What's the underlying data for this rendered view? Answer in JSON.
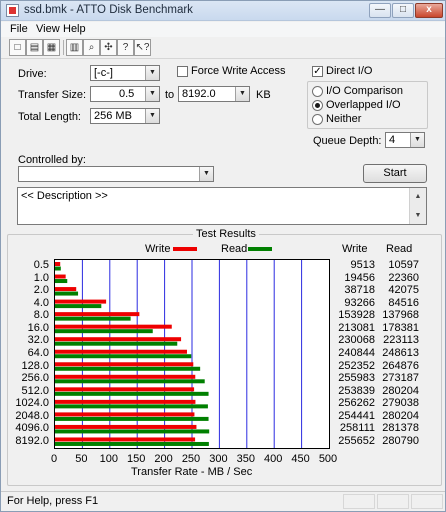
{
  "window": {
    "title": "ssd.bmk - ATTO Disk Benchmark",
    "min_glyph": "—",
    "max_glyph": "□",
    "close_glyph": "x"
  },
  "menu": [
    "File",
    "View",
    "Help"
  ],
  "toolbar": [
    {
      "name": "new-icon",
      "glyph": "□"
    },
    {
      "name": "open-icon",
      "glyph": "▤"
    },
    {
      "name": "save-icon",
      "glyph": "▦"
    },
    {
      "name": "print-icon",
      "glyph": "▥"
    },
    {
      "name": "print-preview-icon",
      "glyph": "⌕"
    },
    {
      "name": "move-icon",
      "glyph": "✣"
    },
    {
      "name": "about-icon",
      "glyph": "?"
    },
    {
      "name": "context-help-icon",
      "glyph": "↖?"
    }
  ],
  "settings": {
    "drive_label": "Drive:",
    "drive_value": "[-c-]",
    "transfer_size_label": "Transfer Size:",
    "transfer_from": "0.5",
    "to_label": "to",
    "transfer_to": "8192.0",
    "kb_label": "KB",
    "total_length_label": "Total Length:",
    "total_length_value": "256 MB",
    "force_write_label": "Force Write Access",
    "force_write_checked": false,
    "direct_io_label": "Direct I/O",
    "direct_io_checked": true,
    "io_options": [
      "I/O Comparison",
      "Overlapped I/O",
      "Neither"
    ],
    "io_selected": 1,
    "queue_depth_label": "Queue Depth:",
    "queue_depth_value": "4",
    "controlled_by_label": "Controlled by:",
    "controlled_by_value": "",
    "start_label": "Start",
    "description_text": "<< Description >>"
  },
  "colors": {
    "write": "#ee0000",
    "read": "#008000",
    "gridline": "#2a2ae0"
  },
  "chart_data": {
    "type": "bar",
    "title": "Test Results",
    "orientation": "horizontal",
    "categories": [
      "0.5",
      "1.0",
      "2.0",
      "4.0",
      "8.0",
      "16.0",
      "32.0",
      "64.0",
      "128.0",
      "256.0",
      "512.0",
      "1024.0",
      "2048.0",
      "4096.0",
      "8192.0"
    ],
    "series": [
      {
        "name": "Write",
        "color": "#ee0000",
        "values": [
          9513,
          19456,
          38718,
          93266,
          153928,
          213081,
          230068,
          240844,
          252352,
          255983,
          253839,
          256262,
          254441,
          258111,
          255652
        ]
      },
      {
        "name": "Read",
        "color": "#008000",
        "values": [
          10597,
          22360,
          42075,
          84516,
          137968,
          178381,
          223113,
          248613,
          264876,
          273187,
          280204,
          279038,
          280204,
          281378,
          280790
        ]
      }
    ],
    "xlabel": "Transfer Rate - MB / Sec",
    "xlim": [
      0,
      500
    ],
    "xticks": [
      "0",
      "50",
      "100",
      "150",
      "200",
      "250",
      "300",
      "350",
      "400",
      "450",
      "500"
    ],
    "value_unit_scale": "thousands per MB/sec",
    "column_headers": [
      "Write",
      "Read"
    ],
    "legend": [
      "Write",
      "Read"
    ],
    "legend_position": "top"
  },
  "status": {
    "text": "For Help, press F1"
  }
}
